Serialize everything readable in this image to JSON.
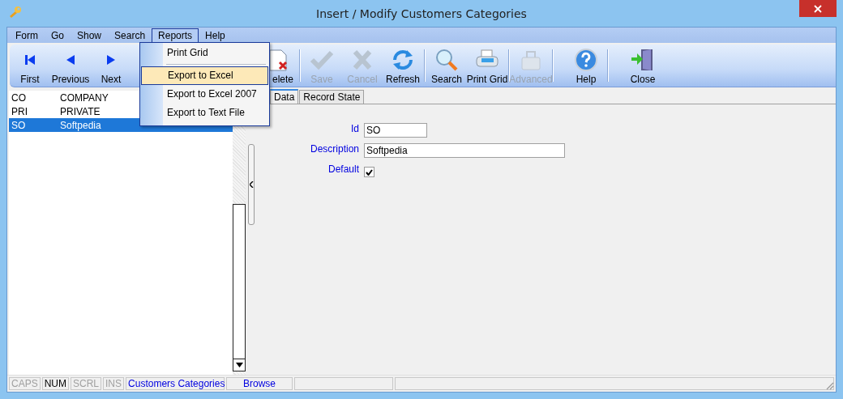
{
  "window": {
    "title": "Insert / Modify Customers Categories"
  },
  "menu": [
    {
      "label": "Form",
      "selected": false
    },
    {
      "label": "Go",
      "selected": false
    },
    {
      "label": "Show",
      "selected": false
    },
    {
      "label": "Search",
      "selected": false
    },
    {
      "label": "Reports",
      "selected": true
    },
    {
      "label": "Help",
      "selected": false
    }
  ],
  "dropdown": [
    {
      "kind": "item",
      "label": "Print Grid",
      "selected": false
    },
    {
      "kind": "separator"
    },
    {
      "kind": "item",
      "label": "Export to Excel",
      "selected": true
    },
    {
      "kind": "item",
      "label": "Export to Excel 2007",
      "selected": false
    },
    {
      "kind": "item",
      "label": "Export to Text File",
      "selected": false
    }
  ],
  "toolbar": [
    {
      "label": "First",
      "disabled": false
    },
    {
      "label": "Previous",
      "disabled": false
    },
    {
      "label": "Next",
      "disabled": false
    },
    {
      "label": "elete",
      "disabled": false
    },
    {
      "label": "Save",
      "disabled": true
    },
    {
      "label": "Cancel",
      "disabled": true
    },
    {
      "label": "Refresh",
      "disabled": false
    },
    {
      "label": "Search",
      "disabled": false
    },
    {
      "label": "Print Grid",
      "disabled": false
    },
    {
      "label": "Advanced",
      "disabled": true
    },
    {
      "label": "Help",
      "disabled": false
    },
    {
      "label": "Close",
      "disabled": false
    }
  ],
  "grid": {
    "rows": [
      {
        "code": "CO",
        "description": "COMPANY",
        "selected": false
      },
      {
        "code": "PRI",
        "description": "PRIVATE",
        "selected": false
      },
      {
        "code": "SO",
        "description": "Softpedia",
        "selected": true
      }
    ]
  },
  "tabs": [
    {
      "label": "Data",
      "selected": true
    },
    {
      "label": "Record State",
      "selected": false
    }
  ],
  "form": {
    "id_label": "Id",
    "id_value": "SO",
    "description_label": "Description",
    "description_value": "Softpedia",
    "default_label": "Default",
    "default_checked": true
  },
  "status_bar": [
    {
      "label": "CAPS",
      "disabled": true
    },
    {
      "label": "NUM",
      "disabled": false
    },
    {
      "label": "SCRL",
      "disabled": true
    },
    {
      "label": "INS",
      "disabled": true
    }
  ],
  "status_form": "Customers Categories",
  "status_mode": "Browse"
}
